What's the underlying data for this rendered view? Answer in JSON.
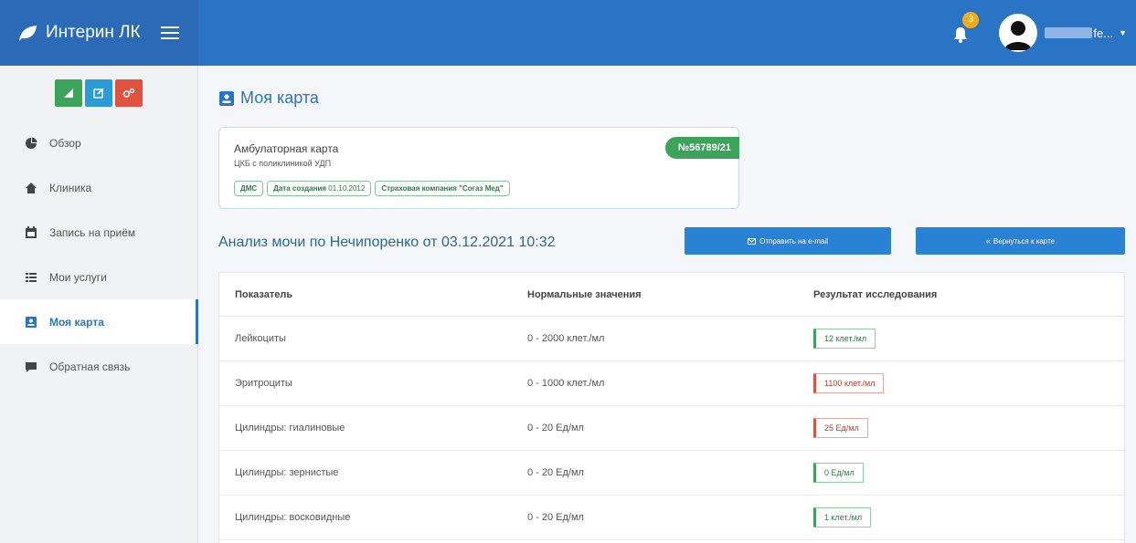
{
  "header": {
    "brand": "Интерин ЛК",
    "notifications_count": "3",
    "username": "fe..."
  },
  "sidebar": {
    "items": [
      {
        "label": "Обзор",
        "icon": "pie-chart-icon"
      },
      {
        "label": "Клиника",
        "icon": "home-icon"
      },
      {
        "label": "Запись на приём",
        "icon": "calendar-icon"
      },
      {
        "label": "Мои услуги",
        "icon": "list-icon"
      },
      {
        "label": "Моя карта",
        "icon": "id-card-icon",
        "active": true
      },
      {
        "label": "Обратная связь",
        "icon": "comment-icon"
      }
    ]
  },
  "main": {
    "title": "Моя карта",
    "card": {
      "title": "Амбулаторная карта",
      "subtitle": "ЦКБ с поликлиникой УДП",
      "number": "№56789/21",
      "tags": {
        "t1": "ДМС",
        "t2_label": "Дата создания",
        "t2_value": "01.10.2012",
        "t3": "Страховая компания \"Согаз Мед\""
      }
    },
    "analysis_title": "Анализ мочи по Нечипоренко от 03.12.2021 10:32",
    "email_button": "Отправить на e-mail",
    "back_button": "Вернуться к карте",
    "table": {
      "headers": [
        "Показатель",
        "Нормальные значения",
        "Результат исследования"
      ],
      "rows": [
        {
          "name": "Лейкоциты",
          "norm": "0 - 2000 клет./мл",
          "result": "12 клет./мл",
          "status": "ok"
        },
        {
          "name": "Эритроциты",
          "norm": "0 - 1000 клет./мл",
          "result": "1100 клет./мл",
          "status": "bad"
        },
        {
          "name": "Цилиндры: гиалиновые",
          "norm": "0 - 20 Ед/мл",
          "result": "25 Ед/мл",
          "status": "bad"
        },
        {
          "name": "Цилиндры: зернистые",
          "norm": "0 - 20 Ед/мл",
          "result": "0 Ед/мл",
          "status": "ok"
        },
        {
          "name": "Цилиндры: восковидные",
          "norm": "0 - 20 Ед/мл",
          "result": "1 клет./мл",
          "status": "ok"
        }
      ]
    }
  },
  "colors": {
    "primary": "#2a74c5",
    "success": "#3ca35b",
    "danger": "#e0513e",
    "warning": "#f0ad18"
  }
}
